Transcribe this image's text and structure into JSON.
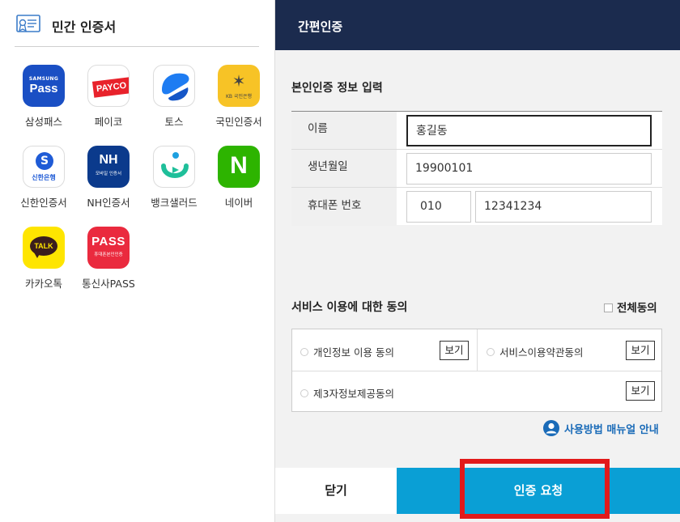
{
  "left_panel": {
    "title": "민간 인증서",
    "apps": [
      {
        "label": "삼성패스",
        "icon": "samsung-pass-icon",
        "icon_text_top": "SAMSUNG",
        "icon_text": "Pass"
      },
      {
        "label": "페이코",
        "icon": "payco-icon",
        "icon_text": "PAYCO"
      },
      {
        "label": "토스",
        "icon": "toss-icon"
      },
      {
        "label": "국민인증서",
        "icon": "kb-icon",
        "icon_text": "KB 국민은행"
      },
      {
        "label": "신한인증서",
        "icon": "shinhan-icon",
        "icon_text": "신한은행"
      },
      {
        "label": "NH인증서",
        "icon": "nh-icon",
        "icon_text": "NH",
        "icon_subtext": "모바일 인증서"
      },
      {
        "label": "뱅크샐러드",
        "icon": "banksalad-icon"
      },
      {
        "label": "네이버",
        "icon": "naver-icon",
        "icon_text": "N"
      },
      {
        "label": "카카오톡",
        "icon": "kakaotalk-icon",
        "icon_text": "TALK"
      },
      {
        "label": "통신사PASS",
        "icon": "pass-icon",
        "icon_text": "PASS",
        "icon_subtext": "휴대폰본인인증"
      }
    ]
  },
  "right_panel": {
    "title": "간편인증",
    "info_section_title": "본인인증 정보 입력",
    "fields": {
      "name_label": "이름",
      "name_value": "홍길동",
      "birth_label": "생년월일",
      "birth_value": "19900101",
      "phone_label": "휴대폰 번호",
      "phone_prefix": "010",
      "phone_number": "12341234"
    },
    "consent_section_title": "서비스 이용에 대한 동의",
    "agree_all_label": "전체동의",
    "terms": [
      {
        "label": "개인정보 이용 동의",
        "button": "보기"
      },
      {
        "label": "서비스이용약관동의",
        "button": "보기"
      },
      {
        "label": "제3자정보제공동의",
        "button": "보기"
      }
    ],
    "manual_link": "사용방법 매뉴얼 안내",
    "close_button": "닫기",
    "request_button": "인증 요청"
  },
  "colors": {
    "header_bg": "#1b2b4e",
    "request_button_bg": "#0a9fd5",
    "highlight_border": "#e21a1a",
    "link": "#1a6bb8"
  }
}
